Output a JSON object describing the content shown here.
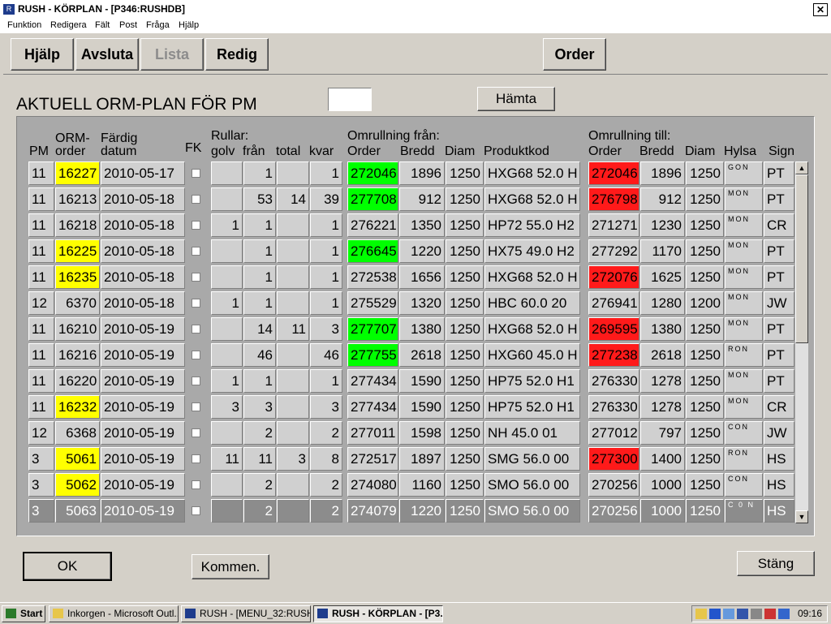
{
  "window": {
    "title": "RUSH - KÖRPLAN - [P346:RUSHDB]",
    "close_glyph": "✕"
  },
  "menu": [
    "Funktion",
    "Redigera",
    "Fält",
    "Post",
    "Fråga",
    "Hjälp"
  ],
  "toolbar": {
    "help": "Hjälp",
    "quit": "Avsluta",
    "list": "Lista",
    "edit": "Redig",
    "order": "Order"
  },
  "heading": "AKTUELL ORM-PLAN FÖR PM",
  "pm_value": "",
  "fetch_label": "Hämta",
  "headers": {
    "group_rolls": "Rullar:",
    "group_from": "Omrullning från:",
    "group_to": "Omrullning till:",
    "pm": "PM",
    "orm_order_1": "ORM-",
    "orm_order_2": "order",
    "fardig_1": "Färdig",
    "fardig_2": "datum",
    "fk": "FK",
    "golv": "golv",
    "fran": "från",
    "total": "total",
    "kvar": "kvar",
    "from_order": "Order",
    "from_bredd": "Bredd",
    "from_diam": "Diam",
    "produktkod": "Produktkod",
    "to_order": "Order",
    "to_bredd": "Bredd",
    "to_diam": "Diam",
    "hylsa": "Hylsa",
    "sign": "Sign"
  },
  "rows": [
    {
      "pm": "11",
      "orm": "16227",
      "orm_hl": "yellow",
      "date": "2010-05-17",
      "golv": "",
      "fran": "1",
      "total": "",
      "kvar": "1",
      "from_order": "272046",
      "from_hl": "green",
      "from_bredd": "1896",
      "from_diam": "1250",
      "produkt": "HXG68 52.0 H",
      "to_order": "272046",
      "to_hl": "red",
      "to_bredd": "1896",
      "to_diam": "1250",
      "hylsa": "GON",
      "sign": "PT"
    },
    {
      "pm": "11",
      "orm": "16213",
      "orm_hl": "",
      "date": "2010-05-18",
      "golv": "",
      "fran": "53",
      "total": "14",
      "kvar": "39",
      "from_order": "277708",
      "from_hl": "green",
      "from_bredd": "912",
      "from_diam": "1250",
      "produkt": "HXG68 52.0 H",
      "to_order": "276798",
      "to_hl": "red",
      "to_bredd": "912",
      "to_diam": "1250",
      "hylsa": "MON",
      "sign": "PT"
    },
    {
      "pm": "11",
      "orm": "16218",
      "orm_hl": "",
      "date": "2010-05-18",
      "golv": "1",
      "fran": "1",
      "total": "",
      "kvar": "1",
      "from_order": "276221",
      "from_hl": "",
      "from_bredd": "1350",
      "from_diam": "1250",
      "produkt": "HP72 55.0 H2",
      "to_order": "271271",
      "to_hl": "",
      "to_bredd": "1230",
      "to_diam": "1250",
      "hylsa": "MON",
      "sign": "CR"
    },
    {
      "pm": "11",
      "orm": "16225",
      "orm_hl": "yellow",
      "date": "2010-05-18",
      "golv": "",
      "fran": "1",
      "total": "",
      "kvar": "1",
      "from_order": "276645",
      "from_hl": "green",
      "from_bredd": "1220",
      "from_diam": "1250",
      "produkt": "HX75 49.0 H2",
      "to_order": "277292",
      "to_hl": "",
      "to_bredd": "1170",
      "to_diam": "1250",
      "hylsa": "MON",
      "sign": "PT"
    },
    {
      "pm": "11",
      "orm": "16235",
      "orm_hl": "yellow",
      "date": "2010-05-18",
      "golv": "",
      "fran": "1",
      "total": "",
      "kvar": "1",
      "from_order": "272538",
      "from_hl": "",
      "from_bredd": "1656",
      "from_diam": "1250",
      "produkt": "HXG68 52.0 H",
      "to_order": "272076",
      "to_hl": "red",
      "to_bredd": "1625",
      "to_diam": "1250",
      "hylsa": "MON",
      "sign": "PT"
    },
    {
      "pm": "12",
      "orm": "6370",
      "orm_hl": "",
      "date": "2010-05-18",
      "golv": "1",
      "fran": "1",
      "total": "",
      "kvar": "1",
      "from_order": "275529",
      "from_hl": "",
      "from_bredd": "1320",
      "from_diam": "1250",
      "produkt": "HBC 60.0 20",
      "to_order": "276941",
      "to_hl": "",
      "to_bredd": "1280",
      "to_diam": "1200",
      "hylsa": "MON",
      "sign": "JW"
    },
    {
      "pm": "11",
      "orm": "16210",
      "orm_hl": "",
      "date": "2010-05-19",
      "golv": "",
      "fran": "14",
      "total": "11",
      "kvar": "3",
      "from_order": "277707",
      "from_hl": "green",
      "from_bredd": "1380",
      "from_diam": "1250",
      "produkt": "HXG68 52.0 H",
      "to_order": "269595",
      "to_hl": "red",
      "to_bredd": "1380",
      "to_diam": "1250",
      "hylsa": "MON",
      "sign": "PT"
    },
    {
      "pm": "11",
      "orm": "16216",
      "orm_hl": "",
      "date": "2010-05-19",
      "golv": "",
      "fran": "46",
      "total": "",
      "kvar": "46",
      "from_order": "277755",
      "from_hl": "green",
      "from_bredd": "2618",
      "from_diam": "1250",
      "produkt": "HXG60 45.0 H",
      "to_order": "277238",
      "to_hl": "red",
      "to_bredd": "2618",
      "to_diam": "1250",
      "hylsa": "RON",
      "sign": "PT"
    },
    {
      "pm": "11",
      "orm": "16220",
      "orm_hl": "",
      "date": "2010-05-19",
      "golv": "1",
      "fran": "1",
      "total": "",
      "kvar": "1",
      "from_order": "277434",
      "from_hl": "",
      "from_bredd": "1590",
      "from_diam": "1250",
      "produkt": "HP75 52.0 H1",
      "to_order": "276330",
      "to_hl": "",
      "to_bredd": "1278",
      "to_diam": "1250",
      "hylsa": "MON",
      "sign": "PT"
    },
    {
      "pm": "11",
      "orm": "16232",
      "orm_hl": "yellow",
      "date": "2010-05-19",
      "golv": "3",
      "fran": "3",
      "total": "",
      "kvar": "3",
      "from_order": "277434",
      "from_hl": "",
      "from_bredd": "1590",
      "from_diam": "1250",
      "produkt": "HP75 52.0 H1",
      "to_order": "276330",
      "to_hl": "",
      "to_bredd": "1278",
      "to_diam": "1250",
      "hylsa": "MON",
      "sign": "CR"
    },
    {
      "pm": "12",
      "orm": "6368",
      "orm_hl": "",
      "date": "2010-05-19",
      "golv": "",
      "fran": "2",
      "total": "",
      "kvar": "2",
      "from_order": "277011",
      "from_hl": "",
      "from_bredd": "1598",
      "from_diam": "1250",
      "produkt": "NH  45.0 01",
      "to_order": "277012",
      "to_hl": "",
      "to_bredd": "797",
      "to_diam": "1250",
      "hylsa": "CON",
      "sign": "JW"
    },
    {
      "pm": "3",
      "orm": "5061",
      "orm_hl": "yellow",
      "date": "2010-05-19",
      "golv": "11",
      "fran": "11",
      "total": "3",
      "kvar": "8",
      "from_order": "272517",
      "from_hl": "",
      "from_bredd": "1897",
      "from_diam": "1250",
      "produkt": "SMG 56.0 00",
      "to_order": "277300",
      "to_hl": "red",
      "to_bredd": "1400",
      "to_diam": "1250",
      "hylsa": "RON",
      "sign": "HS"
    },
    {
      "pm": "3",
      "orm": "5062",
      "orm_hl": "yellow",
      "date": "2010-05-19",
      "golv": "",
      "fran": "2",
      "total": "",
      "kvar": "2",
      "from_order": "274080",
      "from_hl": "",
      "from_bredd": "1160",
      "from_diam": "1250",
      "produkt": "SMO 56.0 00",
      "to_order": "270256",
      "to_hl": "",
      "to_bredd": "1000",
      "to_diam": "1250",
      "hylsa": "CON",
      "sign": "HS"
    },
    {
      "pm": "3",
      "orm": "5063",
      "orm_hl": "yellow",
      "date": "2010-05-19",
      "golv": "",
      "fran": "2",
      "total": "",
      "kvar": "2",
      "from_order": "274079",
      "from_hl": "",
      "from_bredd": "1220",
      "from_diam": "1250",
      "produkt": "SMO 56.0 00",
      "to_order": "270256",
      "to_hl": "",
      "to_bredd": "1000",
      "to_diam": "1250",
      "hylsa": "C 0 N",
      "sign": "HS",
      "selected": true
    }
  ],
  "footer": {
    "ok": "OK",
    "comment": "Kommen.",
    "close": "Stäng"
  },
  "taskbar": {
    "start": "Start",
    "tasks": [
      "Inkorgen - Microsoft Outl...",
      "RUSH - [MENU_32:RUSH...",
      "RUSH - KÖRPLAN - [P3..."
    ],
    "clock": "09:16"
  },
  "colors": {
    "highlight_yellow": "#ffff00",
    "highlight_green": "#00ff00",
    "highlight_red": "#ff1a1a",
    "window_bg": "#d4d0c8"
  }
}
